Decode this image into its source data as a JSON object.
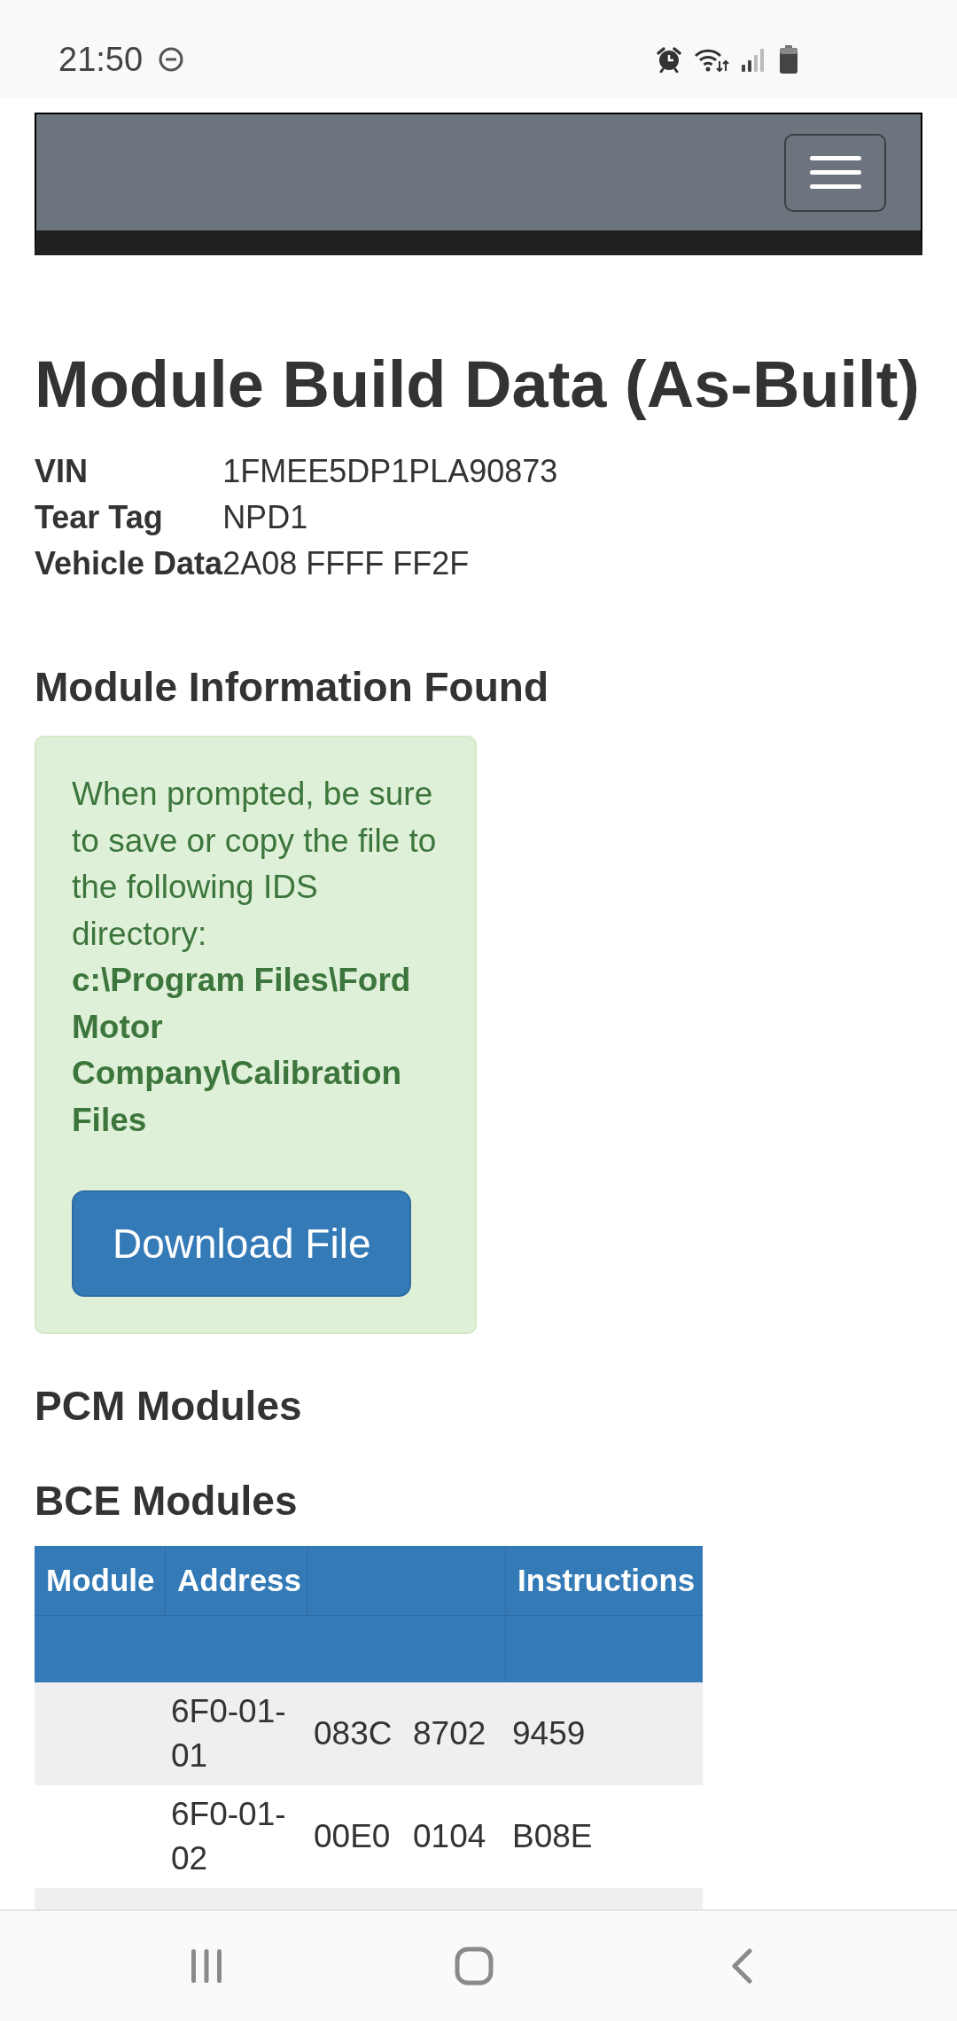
{
  "status_bar": {
    "time": "21:50"
  },
  "page": {
    "title": "Module Build Data (As-Built)",
    "vehicle_info": [
      {
        "label": "VIN",
        "value": "1FMEE5DP1PLA90873"
      },
      {
        "label": "Tear Tag",
        "value": "NPD1"
      },
      {
        "label": "Vehicle Data",
        "value": "2A08 FFFF FF2F"
      }
    ]
  },
  "module_info": {
    "heading": "Module Information Found",
    "alert": {
      "message": "When prompted, be sure to save or copy the file to the following IDS directory:",
      "directory": "c:\\Program Files\\Ford Motor Company\\Calibration Files",
      "button": "Download File"
    }
  },
  "sections": [
    {
      "heading": "PCM Modules"
    },
    {
      "heading": "BCE Modules",
      "table": {
        "columns": [
          {
            "kind": "label",
            "label": "Module"
          },
          {
            "kind": "label",
            "label": "Address"
          },
          {
            "kind": "blank"
          },
          {
            "kind": "label",
            "label": "Instructions"
          }
        ],
        "rows": [
          {
            "address": "6F0-01-01",
            "values": [
              "083C",
              "8702",
              "9459"
            ]
          },
          {
            "address": "6F0-01-02",
            "values": [
              "00E0",
              "0104",
              "B08E"
            ]
          }
        ]
      }
    }
  ]
}
